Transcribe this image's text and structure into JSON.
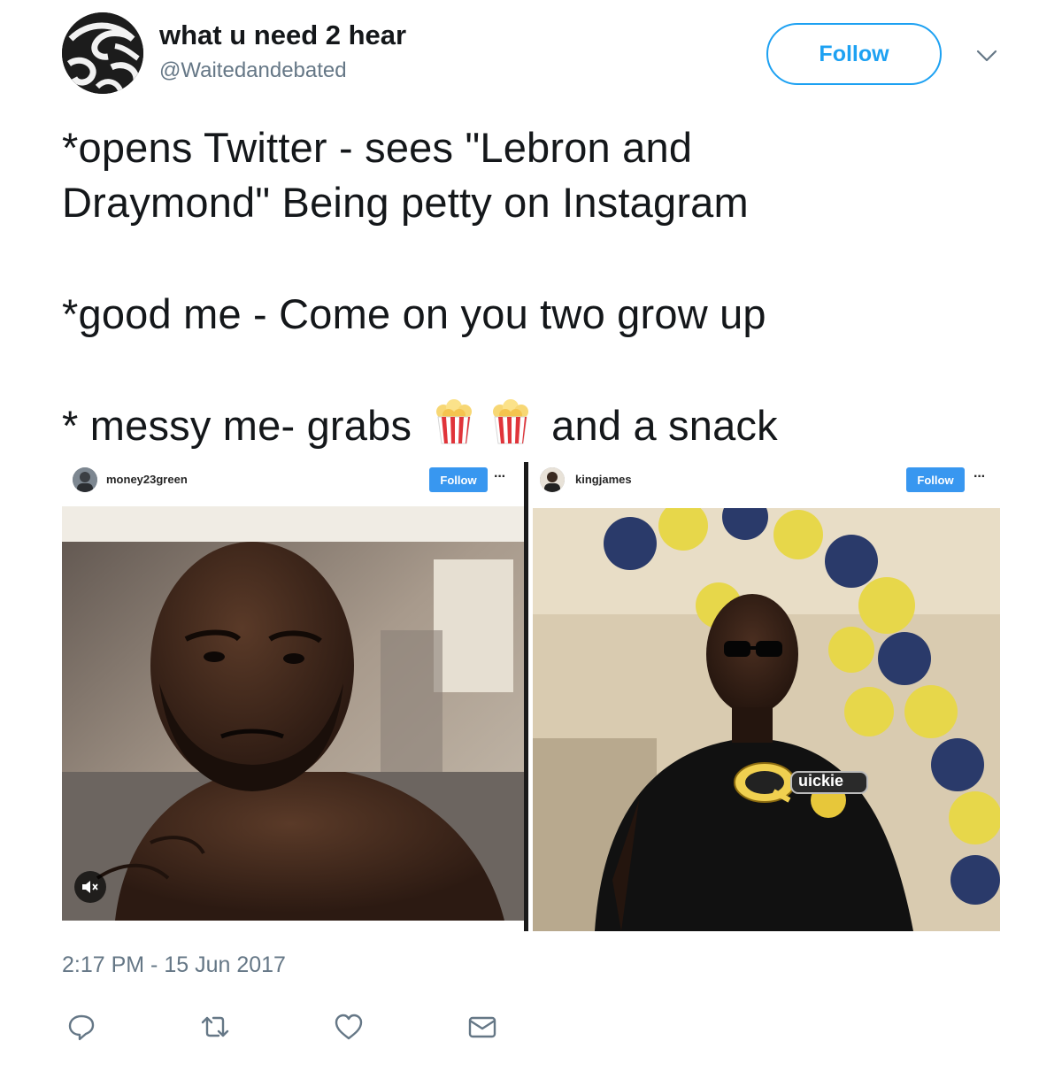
{
  "user": {
    "display_name": "what u need 2 hear",
    "handle": "@Waitedandebated",
    "follow_label": "Follow"
  },
  "tweet": {
    "lines": [
      "*opens Twitter - sees \"Lebron and",
      "Draymond\" Being petty on Instagram",
      "*good me - Come on you two grow up",
      "* messy me- grabs",
      "and a snack"
    ],
    "emoji": [
      "popcorn-icon",
      "popcorn-icon"
    ]
  },
  "media": {
    "left": {
      "username": "money23green",
      "follow_label": "Follow",
      "more_label": "···",
      "icons": [
        "mute-icon"
      ]
    },
    "right": {
      "username": "kingjames",
      "follow_label": "Follow",
      "more_label": "···",
      "shirt_logo_text": "uickie"
    }
  },
  "meta": {
    "timestamp": "2:17 PM - 15 Jun 2017"
  },
  "actions": [
    {
      "name": "reply",
      "icon": "reply-icon"
    },
    {
      "name": "retweet",
      "icon": "retweet-icon"
    },
    {
      "name": "like",
      "icon": "heart-icon"
    },
    {
      "name": "dm",
      "icon": "envelope-icon"
    }
  ],
  "colors": {
    "accent": "#1da1f2",
    "text": "#14171a",
    "muted": "#657786",
    "ig_blue": "#3897f0"
  }
}
